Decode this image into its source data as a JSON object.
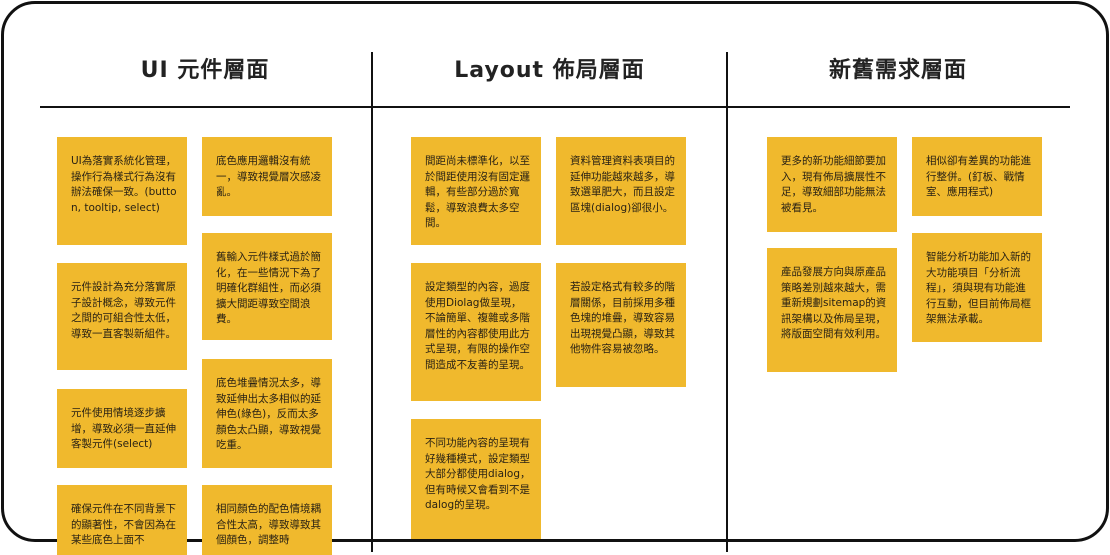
{
  "columns": {
    "ui": {
      "title": "UI 元件層面"
    },
    "layout": {
      "title": "Layout 佈局層面"
    },
    "new_old": {
      "title": "新舊需求層面"
    }
  },
  "notes": {
    "ui_1": "UI為落實系統化管理，操作行為樣式行為沒有辦法確保一致。(button, tooltip, select)",
    "ui_2": "底色應用邏輯沒有統一，導致視覺層次感凌亂。",
    "ui_3": "元件設計為充分落實原子設計概念，導致元件之間的可組合性太低，導致一直客製新組件。",
    "ui_4": "舊輸入元件樣式過於簡化，在一些情況下為了明確化群組性，而必須擴大間距導致空間浪費。",
    "ui_5": "元件使用情境逐步擴增，導致必須一直延伸客製元件(select)",
    "ui_6": "底色堆疊情況太多，導致延伸出太多相似的延伸色(綠色)，反而太多顏色太凸顯，導致視覺吃重。",
    "ui_7": "確保元件在不同背景下的顯著性，不會因為在某些底色上面不",
    "ui_8": "相同顏色的配色情境耦合性太高，導致導致其個顏色，調整時",
    "layout_1": "間距尚未標準化，以至於間距使用沒有固定邏輯，有些部分過於寬鬆，導致浪費太多空間。",
    "layout_2": "資料管理資料表項目的延伸功能越來越多，導致選單肥大，而且設定區塊(dialog)卻很小。",
    "layout_3": "設定類型的內容，過度使用Diolag做呈現，不論簡單、複雜或多階層性的內容都使用此方式呈現，有限的操作空間造成不友善的呈現。",
    "layout_4": "若設定格式有較多的階層關係，目前採用多種色塊的堆疊，導致容易出現視覺凸顯，導致其他物件容易被忽略。",
    "layout_5": "不同功能內容的呈現有好幾種模式，設定類型大部分都使用dialog，但有時候又會看到不是dalog的呈現。",
    "new_1": "更多的新功能細節要加入，現有佈局擴展性不足，導致細部功能無法被看見。",
    "new_2": "相似卻有差異的功能進行整併。(釘板、戰情室、應用程式)",
    "new_3": "產品發展方向與原產品策略差別越來越大，需重新規劃sitemap的資訊架構以及佈局呈現，將版面空間有效利用。",
    "new_4": "智能分析功能加入新的大功能項目「分析流程」，須與現有功能進行互動，但目前佈局框架無法承載。"
  },
  "colors": {
    "sticky_note": "#F0B92D",
    "border": "#111111",
    "title_text": "#222222"
  }
}
